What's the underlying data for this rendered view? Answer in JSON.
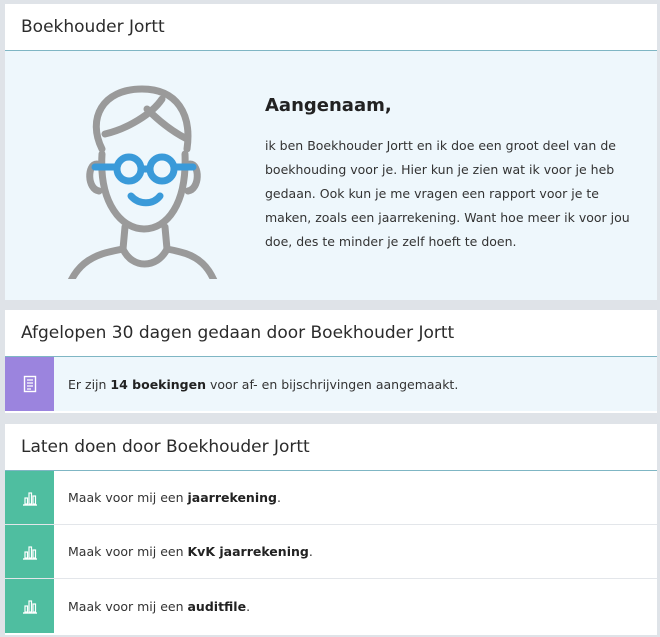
{
  "assistant": {
    "title": "Boekhouder Jortt",
    "greeting": "Aangenaam,",
    "intro": "ik ben Boekhouder Jortt en ik doe een groot deel van de boekhouding voor je. Hier kun je zien wat ik voor je heb gedaan. Ook kun je me vragen een rapport voor je te maken, zoals een jaarrekening. Want hoe meer ik voor jou doe, des te minder je zelf hoeft te doen."
  },
  "activity": {
    "title": "Afgelopen 30 dagen gedaan door Boekhouder Jortt",
    "item": {
      "icon": "receipt-icon",
      "prefix": "Er zijn ",
      "strong": "14 boekingen",
      "suffix": " voor af- en bijschrijvingen aangemaakt."
    }
  },
  "tasks": {
    "title": "Laten doen door Boekhouder Jortt",
    "items": [
      {
        "icon": "bar-chart-icon",
        "prefix": "Maak voor mij een ",
        "strong": "jaarrekening",
        "suffix": "."
      },
      {
        "icon": "bar-chart-icon",
        "prefix": "Maak voor mij een ",
        "strong": "KvK jaarrekening",
        "suffix": "."
      },
      {
        "icon": "bar-chart-icon",
        "prefix": "Maak voor mij een ",
        "strong": "auditfile",
        "suffix": "."
      }
    ]
  },
  "colors": {
    "accent_green": "#4fbea0",
    "accent_purple": "#9b84de",
    "glasses_blue": "#3a9ad9",
    "panel_tint": "#eef7fc"
  }
}
